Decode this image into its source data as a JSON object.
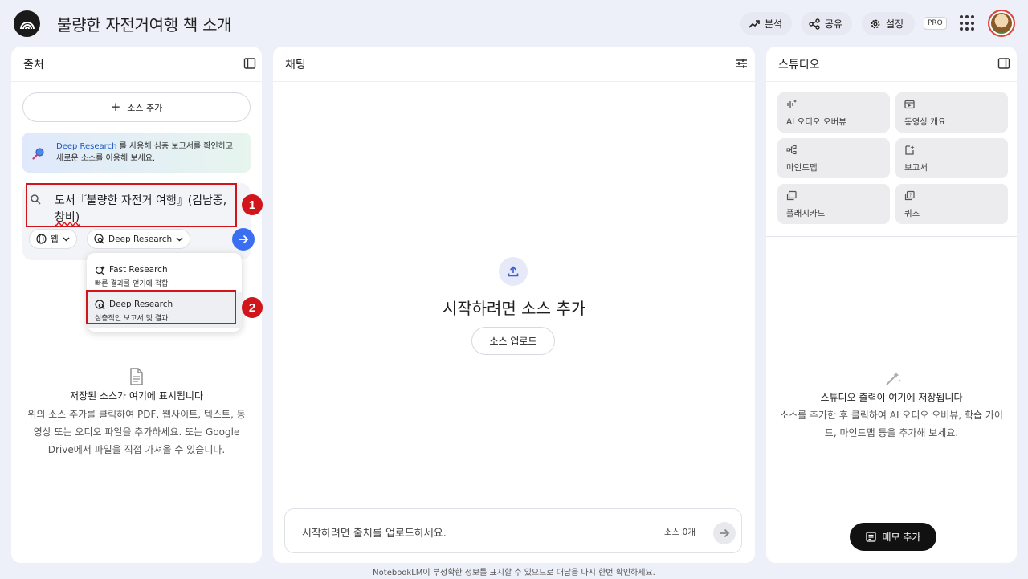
{
  "header": {
    "title": "불량한 자전거여행 책 소개",
    "analyze_label": "분석",
    "share_label": "공유",
    "settings_label": "설정",
    "pro_badge": "PRO"
  },
  "sources": {
    "title": "출처",
    "add_source_label": "소스 추가",
    "banner_link": "Deep Research",
    "banner_text_1": " 를 사용해 심층 보고서를 확인하고",
    "banner_text_2": "새로운 소스를 이용해 보세요.",
    "query_line_1": "도서『불량한 자전거 여행』(김남중,",
    "query_line_2": "창비)",
    "web_chip_label": "웹",
    "mode_chip_label": "Deep Research",
    "dropdown": [
      {
        "name": "Fast Research",
        "desc": "빠른 결과를 얻기에 적합"
      },
      {
        "name": "Deep Research",
        "desc": "심층적인 보고서 및 결과"
      }
    ],
    "annotation_1": "1",
    "annotation_2": "2",
    "empty_title": "저장된 소스가 여기에 표시됩니다",
    "empty_line_1": "위의 소스 추가를 클릭하여 PDF, 웹사이트, 텍스트, 동",
    "empty_line_2": "영상 또는 오디오 파일을 추가하세요. 또는 Google",
    "empty_line_3": "Drive에서 파일을 직접 가져올 수 있습니다."
  },
  "chat": {
    "title": "채팅",
    "heading": "시작하려면 소스 추가",
    "upload_label": "소스 업로드",
    "input_placeholder": "시작하려면 출처를 업로드하세요.",
    "source_count": "소스 0개"
  },
  "studio": {
    "title": "스튜디오",
    "tiles": [
      {
        "label": "AI 오디오 오버뷰",
        "icon": "audio-waveform-icon"
      },
      {
        "label": "동영상 개요",
        "icon": "video-icon"
      },
      {
        "label": "마인드맵",
        "icon": "mindmap-icon"
      },
      {
        "label": "보고서",
        "icon": "report-icon"
      },
      {
        "label": "플래시카드",
        "icon": "flashcard-icon"
      },
      {
        "label": "퀴즈",
        "icon": "quiz-icon"
      }
    ],
    "empty_title": "스튜디오 출력이 여기에 저장됩니다",
    "empty_line_1": "소스를 추가한 후 클릭하여 AI 오디오 오버뷰, 학습 가이",
    "empty_line_2": "드, 마인드맵 등을 추가해 보세요.",
    "memo_label": "메모 추가"
  },
  "footer": "NotebookLM이 부정확한 정보를 표시할 수 있으므로 대답을 다시 한번 확인하세요.",
  "colors": {
    "accent": "#3b6ff2",
    "annotation_red": "#d1161b",
    "background": "#eef0f9"
  }
}
